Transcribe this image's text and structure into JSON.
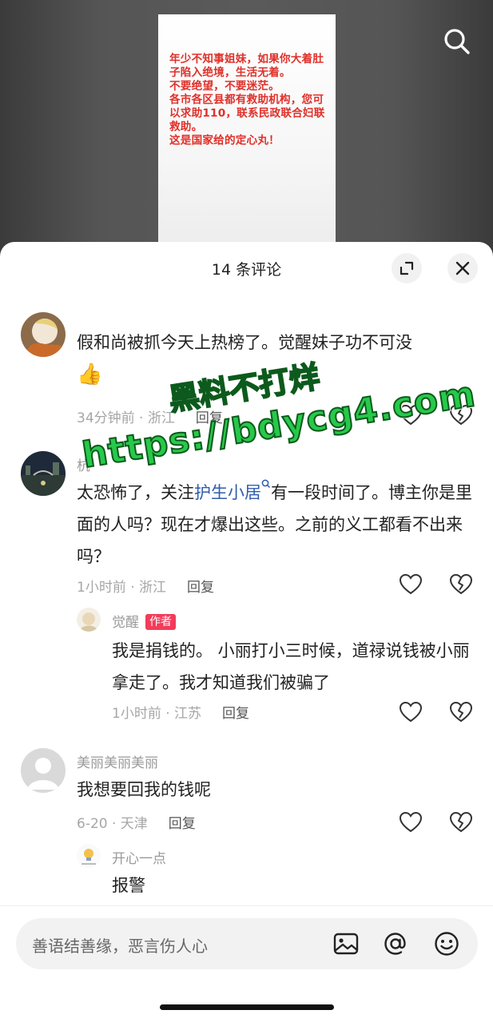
{
  "video": {
    "card_text": "年少不知事姐妹，如果你大着肚子陷入绝境，生活无着。\n不要绝望，不要迷茫。\n各市各区县都有救助机构，您可以求助110，联系民政联合妇联救助。\n这是国家给的定心丸！"
  },
  "sheet": {
    "title": "14 条评论"
  },
  "comments": [
    {
      "user": "",
      "text": "假和尚被抓今天上热榜了。觉醒妹子功不可没",
      "emoji": "👍",
      "time_loc": "34分钟前 · 浙江",
      "reply_label": "回复"
    },
    {
      "user": "杭",
      "text_before": "太恐怖了，关注",
      "topic": "护生小居",
      "text_after": "有一段时间了。博主你是里面的人吗？现在才爆出这些。之前的义工都看不出来吗？",
      "time_loc": "1小时前 · 浙江",
      "reply_label": "回复"
    },
    {
      "user": "觉醒",
      "badge": "作者",
      "text": "我是捐钱的。 小丽打小三时候，道禄说钱被小丽拿走了。我才知道我们被骗了",
      "time_loc": "1小时前 · 江苏",
      "reply_label": "回复"
    },
    {
      "user": "美丽美丽美丽",
      "text": "我想要回我的钱呢",
      "time_loc": "6-20 · 天津",
      "reply_label": "回复"
    },
    {
      "user": "开心一点",
      "text": "报警"
    }
  ],
  "watermark": {
    "line1": "黑料不打烊",
    "line2": "https://bdycg4.com"
  },
  "input": {
    "placeholder": "善语结善缘，恶言伤人心"
  },
  "icons": {
    "search": "search-icon",
    "expand": "expand-icon",
    "close": "close-icon",
    "like": "heart-outline-icon",
    "dislike": "broken-heart-icon",
    "image": "image-icon",
    "mention": "at-icon",
    "emoji": "emoji-icon"
  }
}
